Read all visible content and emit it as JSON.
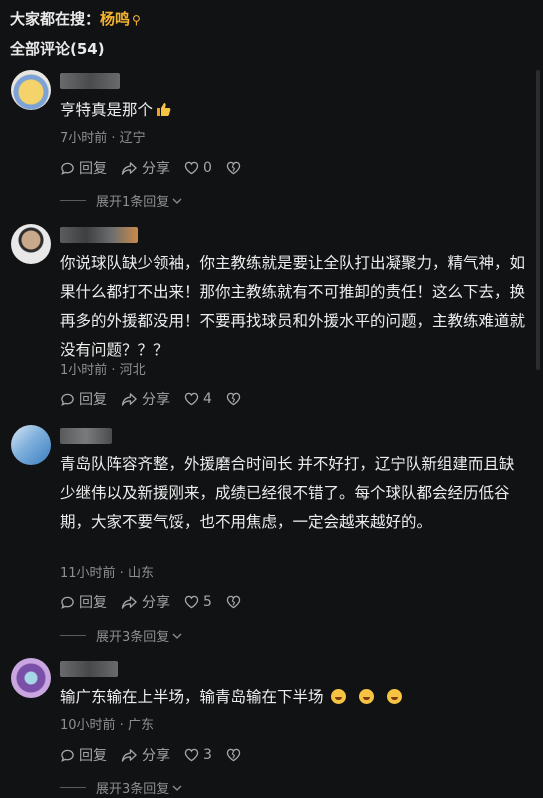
{
  "header": {
    "label": "大家都在搜：",
    "query": "杨鸣"
  },
  "comments_count": "全部评论(54)",
  "comments": [
    {
      "text": "亨特真是那个",
      "time": "7小时前 · 辽宁",
      "reply": "回复",
      "share": "分享",
      "likes": "0",
      "expand": "展开1条回复"
    },
    {
      "text": "你说球队缺少领袖，你主教练就是要让全队打出凝聚力，精气神，如果什么都打不出来！那你主教练就有不可推卸的责任！这么下去，换再多的外援都没用！不要再找球员和外援水平的问题，主教练难道就没有问题？？？",
      "time": "1小时前 · 河北",
      "reply": "回复",
      "share": "分享",
      "likes": "4"
    },
    {
      "text": "青岛队阵容齐整，外援磨合时间长 并不好打，辽宁队新组建而且缺少继伟以及新援刚来，成绩已经很不错了。每个球队都会经历低谷期，大家不要气馁，也不用焦虑，一定会越来越好的。",
      "time": "11小时前 · 山东",
      "reply": "回复",
      "share": "分享",
      "likes": "5",
      "expand": "展开3条回复"
    },
    {
      "text": "输广东输在上半场，输青岛输在下半场",
      "time": "10小时前 · 广东",
      "reply": "回复",
      "share": "分享",
      "likes": "3",
      "expand": "展开3条回复"
    }
  ],
  "colors": {
    "accent": "#f5b430",
    "background": "#111213"
  }
}
